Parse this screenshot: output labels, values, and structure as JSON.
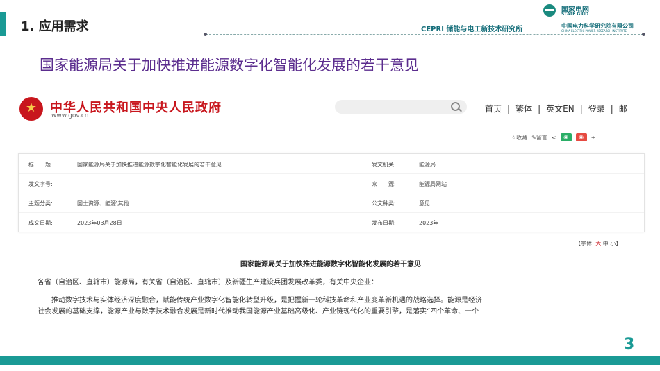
{
  "header": {
    "section_title": "1. 应用需求",
    "institute": "CEPRI 储能与电工新技术研究所",
    "logo_sgcc_cn": "国家电网",
    "logo_sgcc_en": "STATE GRID",
    "logo_epri_cn": "中国电力科学研究院有限公司",
    "logo_epri_en": "CHINA ELECTRIC POWER RESEARCH INSTITUTE"
  },
  "slide": {
    "headline": "国家能源局关于加快推进能源数字化智能化发展的若干意见",
    "page_number": "3"
  },
  "gov_site": {
    "name": "中华人民共和国中央人民政府",
    "domain": "www.gov.cn",
    "nav": [
      "首页",
      "繁体",
      "英文EN",
      "登录",
      "邮"
    ],
    "nav_sep": "|",
    "tools": {
      "favorite": "☆收藏",
      "comment": "✎留言",
      "share": "<"
    },
    "meta": [
      {
        "k1": "标　　题:",
        "v1": "国家能源局关于加快推进能源数字化智能化发展的若干意见",
        "k2": "发文机关:",
        "v2": "能源局"
      },
      {
        "k1": "发文字号:",
        "v1": "",
        "k2": "来　　源:",
        "v2": "能源局网站"
      },
      {
        "k1": "主题分类:",
        "v1": "国土资源、能源\\其他",
        "k2": "公文种类:",
        "v2": "意见"
      },
      {
        "k1": "成文日期:",
        "v1": "2023年03月28日",
        "k2": "发布日期:",
        "v2": "2023年"
      }
    ],
    "font_size": {
      "label": "【字体:",
      "big": "大",
      "mid": "中",
      "small": "小】"
    },
    "doc_title": "国家能源局关于加快推进能源数字化智能化发展的若干意见",
    "paragraphs": [
      "各省（自治区、直辖市）能源局，有关省（自治区、直辖市）及新疆生产建设兵团发展改革委，有关中央企业：",
      "推动数字技术与实体经济深度融合，赋能传统产业数字化智能化转型升级，是把握新一轮科技革命和产业变革新机遇的战略选择。能源是经济",
      "社会发展的基础支撑，能源产业与数字技术融合发展是新时代推动我国能源产业基础高级化、产业链现代化的重要引擎，是落实“四个革命、一个"
    ]
  },
  "colors": {
    "teal": "#1a9a95",
    "purple": "#5b2d8e",
    "gov_red": "#c8161d"
  }
}
